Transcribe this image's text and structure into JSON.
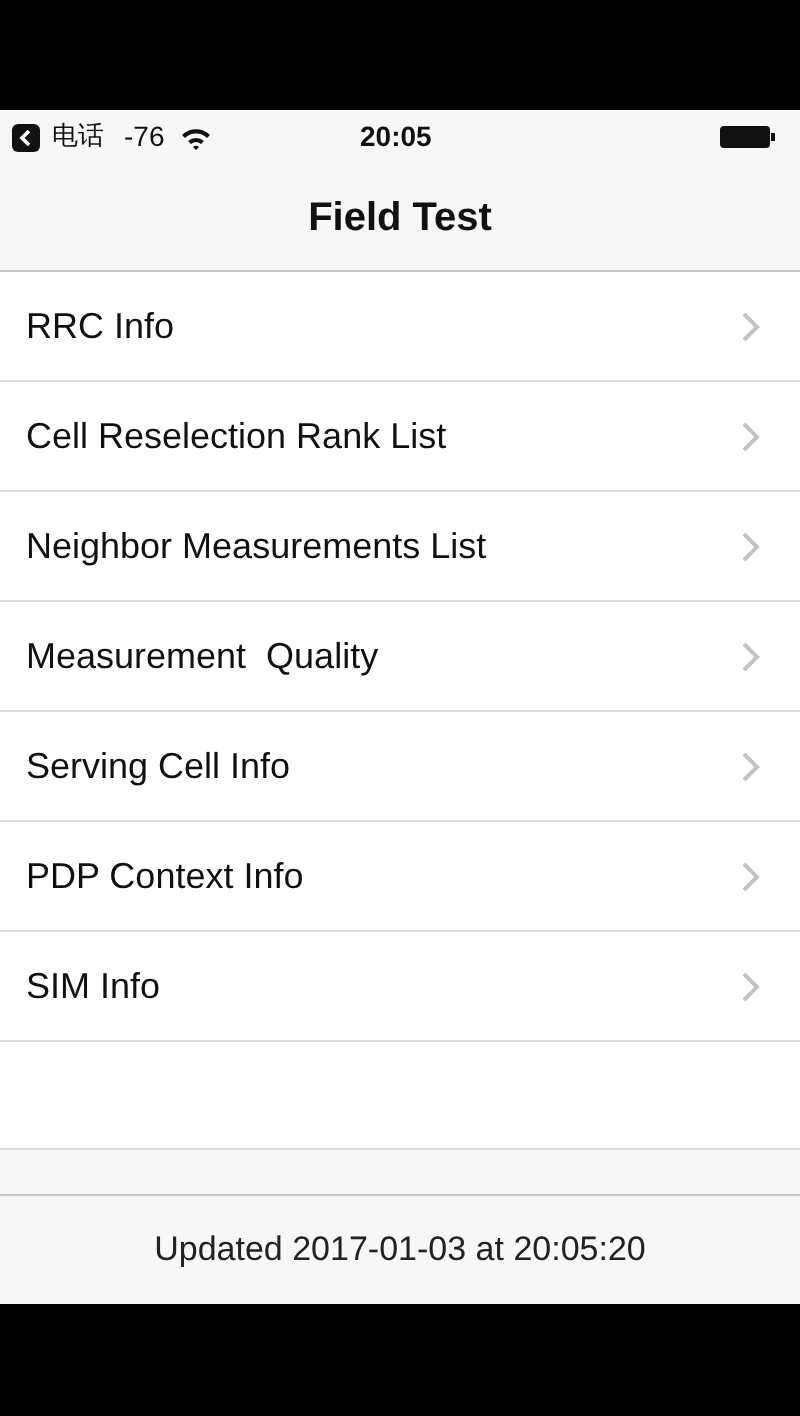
{
  "status_bar": {
    "back_label": "电话",
    "signal": "-76",
    "time": "20:05"
  },
  "nav": {
    "title": "Field Test"
  },
  "items": [
    {
      "label": "RRC Info"
    },
    {
      "label": "Cell Reselection Rank List"
    },
    {
      "label": "Neighbor Measurements List"
    },
    {
      "label": "Measurement  Quality"
    },
    {
      "label": "Serving Cell Info"
    },
    {
      "label": "PDP Context Info"
    },
    {
      "label": "SIM Info"
    }
  ],
  "footer": {
    "text": "Updated 2017-01-03 at 20:05:20"
  }
}
